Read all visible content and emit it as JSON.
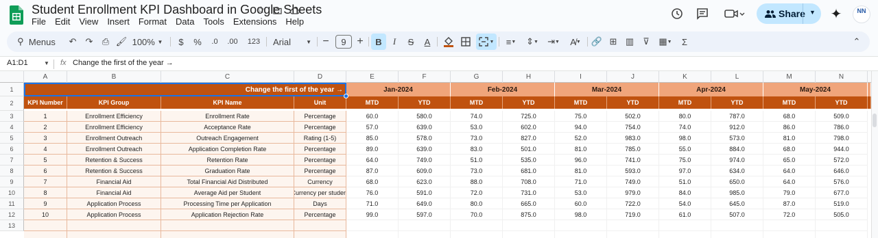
{
  "app": {
    "title": "Student Enrollment KPI Dashboard in Google Sheets",
    "menus": [
      "File",
      "Edit",
      "View",
      "Insert",
      "Format",
      "Data",
      "Tools",
      "Extensions",
      "Help"
    ],
    "share_label": "Share",
    "avatar_text": "NN"
  },
  "toolbar": {
    "menus_label": "Menus",
    "zoom": "100%",
    "currency": "$",
    "percent": "%",
    "dec_less": ".0",
    "dec_more": ".00",
    "format_123": "123",
    "font": "Arial",
    "font_size": "9",
    "bold": "B",
    "italic": "I",
    "strike": "S",
    "textcolor": "A"
  },
  "formula_bar": {
    "name_box": "A1:D1",
    "fx": "fx",
    "value": "Change the first of the year →"
  },
  "columns": [
    "A",
    "B",
    "C",
    "D",
    "E",
    "F",
    "G",
    "H",
    "I",
    "J",
    "K",
    "L",
    "M",
    "N"
  ],
  "sheet": {
    "header_note": "Change the first of the year →",
    "months": [
      "Jan-2024",
      "Feb-2024",
      "Mar-2024",
      "Apr-2024",
      "May-2024"
    ],
    "kpi_headers": [
      "KPI Number",
      "KPI Group",
      "KPI Name",
      "Unit"
    ],
    "mtd": "MTD",
    "ytd": "YTD",
    "rows": [
      {
        "n": "1",
        "group": "Enrollment Efficiency",
        "name": "Enrollment Rate",
        "unit": "Percentage",
        "vals": [
          "60.0",
          "580.0",
          "74.0",
          "725.0",
          "75.0",
          "502.0",
          "80.0",
          "787.0",
          "68.0",
          "509.0"
        ]
      },
      {
        "n": "2",
        "group": "Enrollment Efficiency",
        "name": "Acceptance Rate",
        "unit": "Percentage",
        "vals": [
          "57.0",
          "639.0",
          "53.0",
          "602.0",
          "94.0",
          "754.0",
          "74.0",
          "912.0",
          "86.0",
          "786.0"
        ]
      },
      {
        "n": "3",
        "group": "Enrollment Outreach",
        "name": "Outreach Engagement",
        "unit": "Rating (1-5)",
        "vals": [
          "85.0",
          "578.0",
          "73.0",
          "827.0",
          "52.0",
          "983.0",
          "98.0",
          "573.0",
          "81.0",
          "798.0"
        ]
      },
      {
        "n": "4",
        "group": "Enrollment Outreach",
        "name": "Application Completion Rate",
        "unit": "Percentage",
        "vals": [
          "89.0",
          "639.0",
          "83.0",
          "501.0",
          "81.0",
          "785.0",
          "55.0",
          "884.0",
          "68.0",
          "944.0"
        ]
      },
      {
        "n": "5",
        "group": "Retention & Success",
        "name": "Retention Rate",
        "unit": "Percentage",
        "vals": [
          "64.0",
          "749.0",
          "51.0",
          "535.0",
          "96.0",
          "741.0",
          "75.0",
          "974.0",
          "65.0",
          "572.0"
        ]
      },
      {
        "n": "6",
        "group": "Retention & Success",
        "name": "Graduation Rate",
        "unit": "Percentage",
        "vals": [
          "87.0",
          "609.0",
          "73.0",
          "681.0",
          "81.0",
          "593.0",
          "97.0",
          "634.0",
          "64.0",
          "646.0"
        ]
      },
      {
        "n": "7",
        "group": "Financial Aid",
        "name": "Total Financial Aid Distributed",
        "unit": "Currency",
        "vals": [
          "68.0",
          "623.0",
          "88.0",
          "708.0",
          "71.0",
          "749.0",
          "51.0",
          "650.0",
          "64.0",
          "576.0"
        ]
      },
      {
        "n": "8",
        "group": "Financial Aid",
        "name": "Average Aid per Student",
        "unit": "Currency per student",
        "vals": [
          "76.0",
          "591.0",
          "72.0",
          "731.0",
          "53.0",
          "979.0",
          "84.0",
          "985.0",
          "79.0",
          "677.0"
        ]
      },
      {
        "n": "9",
        "group": "Application Process",
        "name": "Processing Time per Application",
        "unit": "Days",
        "vals": [
          "71.0",
          "649.0",
          "80.0",
          "665.0",
          "60.0",
          "722.0",
          "54.0",
          "645.0",
          "87.0",
          "519.0"
        ]
      },
      {
        "n": "10",
        "group": "Application Process",
        "name": "Application Rejection Rate",
        "unit": "Percentage",
        "vals": [
          "99.0",
          "597.0",
          "70.0",
          "875.0",
          "98.0",
          "719.0",
          "61.0",
          "507.0",
          "72.0",
          "505.0"
        ]
      }
    ]
  },
  "row_numbers": [
    "1",
    "2",
    "3",
    "4",
    "5",
    "6",
    "7",
    "8",
    "9",
    "10",
    "11",
    "12",
    "13"
  ]
}
